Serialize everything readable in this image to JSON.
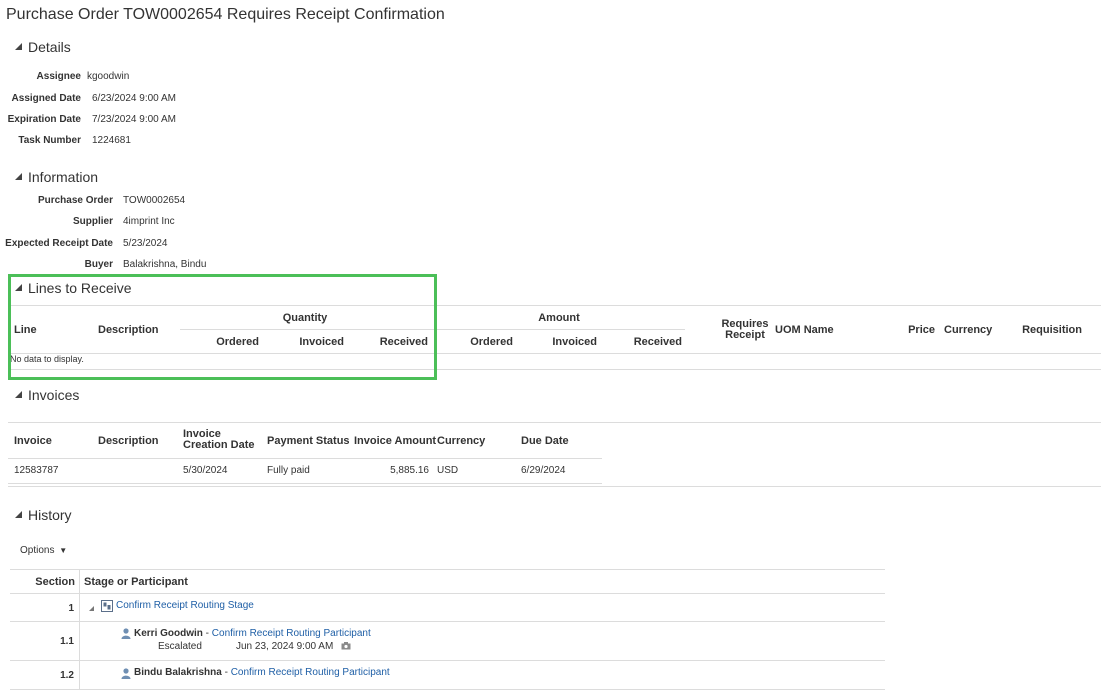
{
  "page": {
    "title": "Purchase Order TOW0002654 Requires Receipt Confirmation"
  },
  "details": {
    "title": "Details",
    "fields": [
      {
        "label": "Assignee",
        "value": "kgoodwin"
      },
      {
        "label": "Assigned Date",
        "value": "6/23/2024 9:00 AM"
      },
      {
        "label": "Expiration Date",
        "value": "7/23/2024 9:00 AM"
      },
      {
        "label": "Task Number",
        "value": "1224681"
      }
    ]
  },
  "information": {
    "title": "Information",
    "fields": [
      {
        "label": "Purchase Order",
        "value": "TOW0002654"
      },
      {
        "label": "Supplier",
        "value": "4imprint Inc"
      },
      {
        "label": "Expected Receipt Date",
        "value": "5/23/2024"
      },
      {
        "label": "Buyer",
        "value": "Balakrishna, Bindu"
      }
    ]
  },
  "lines_to_receive": {
    "title": "Lines to Receive",
    "group_quantity": "Quantity",
    "group_amount": "Amount",
    "columns": {
      "line": "Line",
      "description": "Description",
      "qty_ordered": "Ordered",
      "qty_invoiced": "Invoiced",
      "qty_received": "Received",
      "amt_ordered": "Ordered",
      "amt_invoiced": "Invoiced",
      "amt_received": "Received",
      "requires_receipt_1": "Requires",
      "requires_receipt_2": "Receipt",
      "uom_name": "UOM Name",
      "price": "Price",
      "currency": "Currency",
      "requisition": "Requisition"
    },
    "empty_text": "No data to display."
  },
  "invoices": {
    "title": "Invoices",
    "columns": {
      "invoice": "Invoice",
      "description": "Description",
      "creation_date_1": "Invoice",
      "creation_date_2": "Creation Date",
      "payment_status": "Payment Status",
      "invoice_amount": "Invoice Amount",
      "currency": "Currency",
      "due_date": "Due Date"
    },
    "rows": [
      {
        "invoice": "12583787",
        "description": "",
        "creation_date": "5/30/2024",
        "payment_status": "Fully paid",
        "invoice_amount": "5,885.16",
        "currency": "USD",
        "due_date": "6/29/2024"
      }
    ]
  },
  "history": {
    "title": "History",
    "options_label": "Options",
    "columns": {
      "section": "Section",
      "stage": "Stage or Participant"
    },
    "rows": [
      {
        "section": "1",
        "stage_link": "Confirm Receipt Routing Stage"
      },
      {
        "section": "1.1",
        "participant": "Kerri Goodwin",
        "separator": " - ",
        "link": "Confirm Receipt Routing Participant",
        "status": "Escalated",
        "date": "Jun 23, 2024 9:00 AM"
      },
      {
        "section": "1.2",
        "participant": "Bindu Balakrishna",
        "separator": " - ",
        "link": "Confirm Receipt Routing Participant"
      }
    ]
  },
  "colors": {
    "link": "#1f5fa6",
    "highlight": "#4bbf58",
    "divider": "#dcdcdc"
  },
  "icons": [
    "collapse-triangle-icon",
    "stage-icon",
    "person-icon",
    "camera-icon",
    "dropdown-arrow-icon"
  ]
}
